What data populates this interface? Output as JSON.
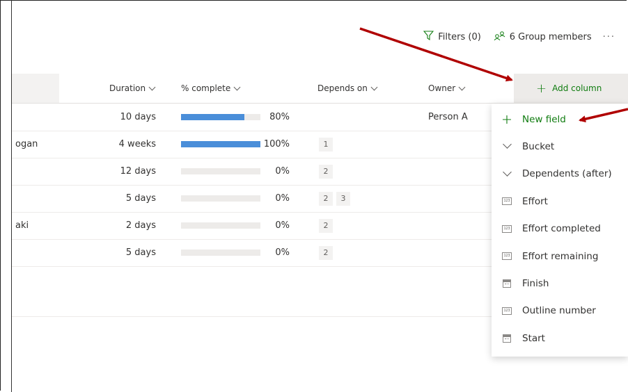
{
  "toolbar": {
    "filters_label": "Filters (0)",
    "members_label": "6 Group members",
    "more_label": "···"
  },
  "columns": {
    "duration": "Duration",
    "percent_complete": "% complete",
    "depends_on": "Depends on",
    "owner": "Owner",
    "add_column": "Add column"
  },
  "rows": [
    {
      "name_fragment": "",
      "duration": "10 days",
      "progress": 0.8,
      "percent": "80%",
      "depends": [],
      "owner": "Person A"
    },
    {
      "name_fragment": "ogan",
      "duration": "4 weeks",
      "progress": 1.0,
      "percent": "100%",
      "depends": [
        "1"
      ],
      "owner": ""
    },
    {
      "name_fragment": "",
      "duration": "12 days",
      "progress": 0,
      "percent": "0%",
      "depends": [
        "2"
      ],
      "owner": ""
    },
    {
      "name_fragment": "",
      "duration": "5 days",
      "progress": 0,
      "percent": "0%",
      "depends": [
        "2",
        "3"
      ],
      "owner": ""
    },
    {
      "name_fragment": "aki",
      "duration": "2 days",
      "progress": 0,
      "percent": "0%",
      "depends": [
        "2"
      ],
      "owner": ""
    },
    {
      "name_fragment": "",
      "duration": "5 days",
      "progress": 0,
      "percent": "0%",
      "depends": [
        "2"
      ],
      "owner": ""
    }
  ],
  "menu": {
    "items": [
      {
        "label": "New field",
        "icon": "plus-icon"
      },
      {
        "label": "Bucket",
        "icon": "chevron-down-icon"
      },
      {
        "label": "Dependents (after)",
        "icon": "chevron-down-icon"
      },
      {
        "label": "Effort",
        "icon": "number-field-icon"
      },
      {
        "label": "Effort completed",
        "icon": "number-field-icon"
      },
      {
        "label": "Effort remaining",
        "icon": "number-field-icon"
      },
      {
        "label": "Finish",
        "icon": "calendar-icon"
      },
      {
        "label": "Outline number",
        "icon": "number-field-icon"
      },
      {
        "label": "Start",
        "icon": "calendar-icon"
      }
    ]
  },
  "colors": {
    "accent_green": "#107c10",
    "progress_blue": "#4a8ed9",
    "annotation_arrow": "#b00000"
  }
}
